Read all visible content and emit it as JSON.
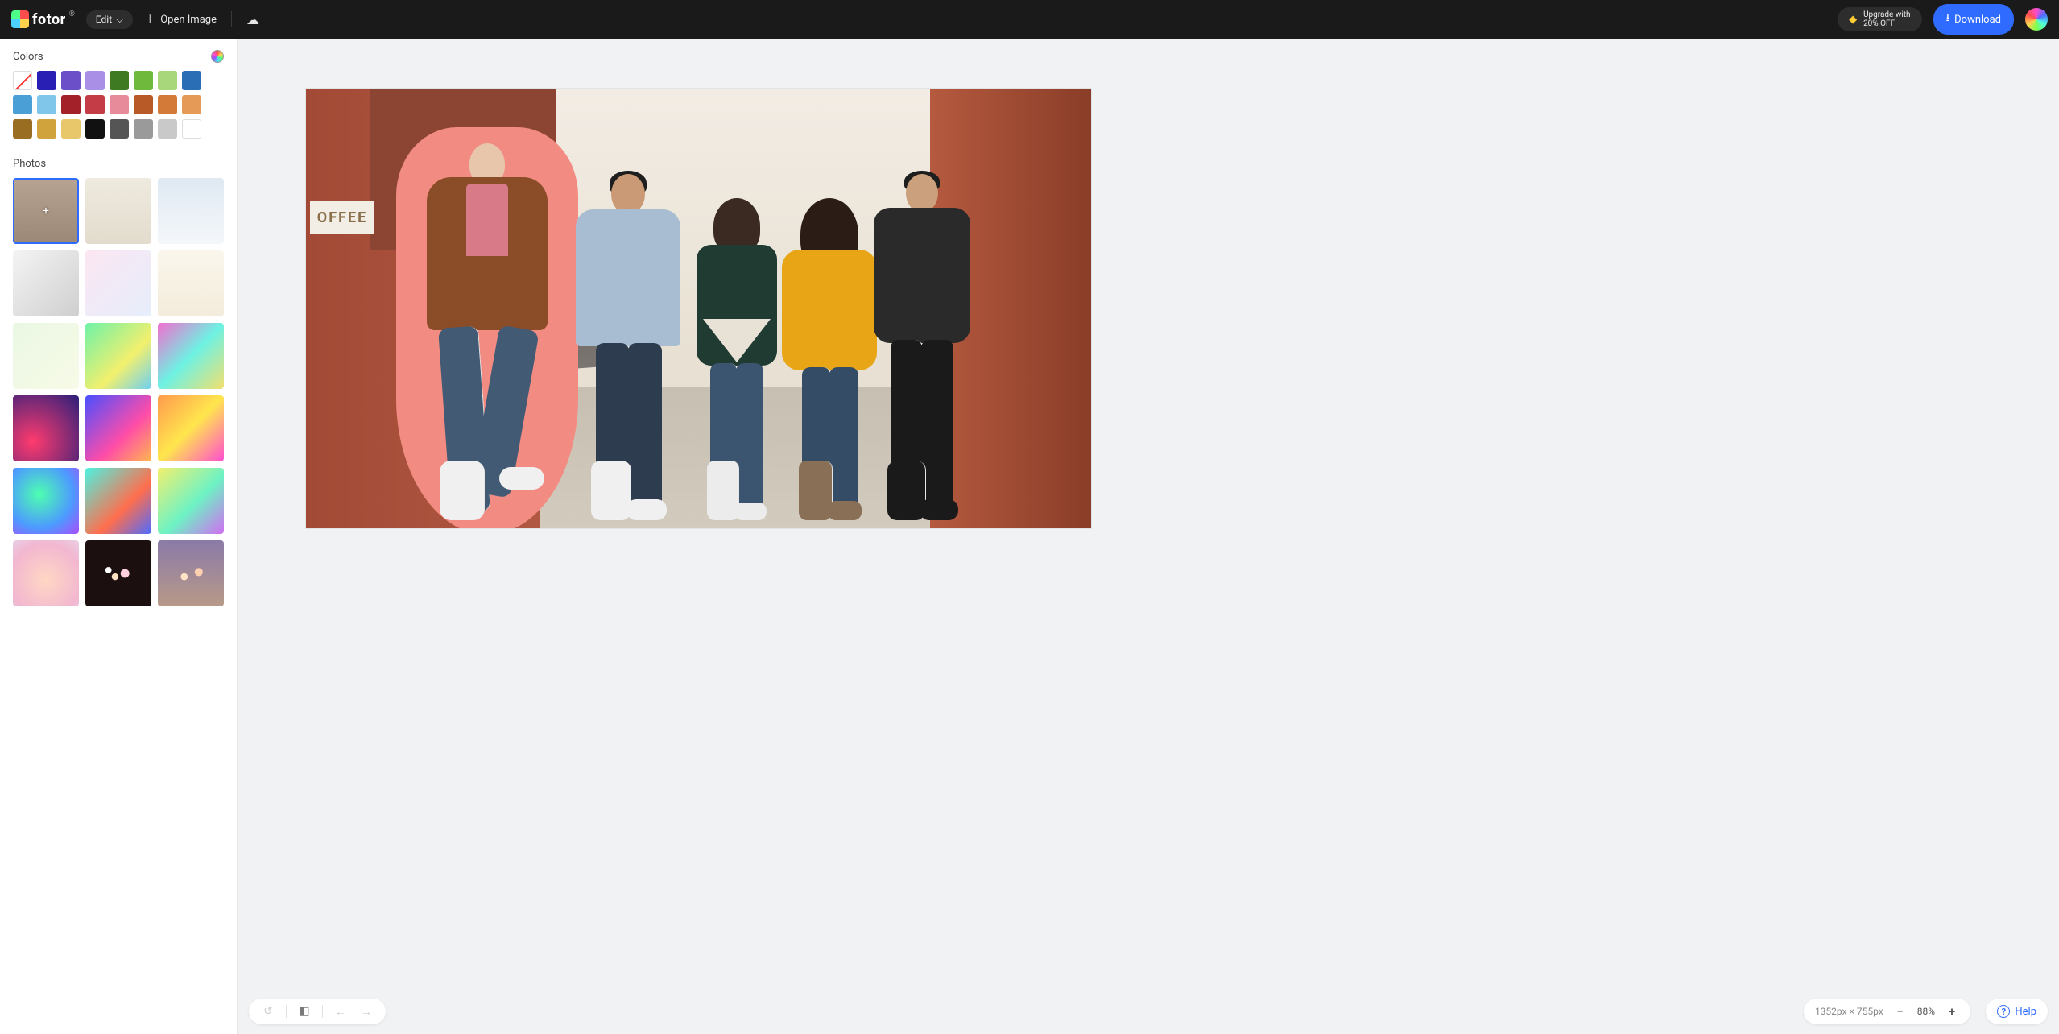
{
  "brand": {
    "name": "fotor"
  },
  "topbar": {
    "edit_label": "Edit",
    "open_image_label": "Open Image",
    "upgrade_line1": "Upgrade with",
    "upgrade_line2": "20% OFF",
    "download_label": "Download"
  },
  "sidebar": {
    "colors_title": "Colors",
    "photos_title": "Photos",
    "swatches": [
      "none",
      "#2a1fb5",
      "#6a4fc9",
      "#a98fe6",
      "#3d7a22",
      "#6fba3d",
      "#a8d67b",
      "#2a6fb5",
      "#4a9fd6",
      "#7fc6ea",
      "#a3222a",
      "#c43d46",
      "#e78a9a",
      "#b85a28",
      "#d47a38",
      "#e69a58",
      "#9a6e22",
      "#d1a33d",
      "#e8c76a",
      "#111111",
      "#555555",
      "#9a9a9a",
      "#c9c9c9",
      "#ffffff"
    ],
    "photos": [
      {
        "selected": true,
        "bg": "linear-gradient(#b7a391,#9c8876)"
      },
      {
        "selected": false,
        "bg": "linear-gradient(#efeadf,#e2dccd)"
      },
      {
        "selected": false,
        "bg": "linear-gradient(#dfe9f2,#f4f7fa)"
      },
      {
        "selected": false,
        "bg": "linear-gradient(135deg,#f4f4f4,#cfcfcf)"
      },
      {
        "selected": false,
        "bg": "linear-gradient(135deg,#fce6f2,#e6eefc)"
      },
      {
        "selected": false,
        "bg": "linear-gradient(#fbf6ec,#f3ecdb)"
      },
      {
        "selected": false,
        "bg": "linear-gradient(135deg,#eaf7e2,#f7fbe8)"
      },
      {
        "selected": false,
        "bg": "linear-gradient(135deg,#6ef2a8,#f2f06e 60%,#6ecff2)"
      },
      {
        "selected": false,
        "bg": "linear-gradient(135deg,#f26ed0,#6ef2e3 50%,#f2e06e)"
      },
      {
        "selected": false,
        "bg": "radial-gradient(circle at 30% 70%,#ff3b6e,#2a1f7a)"
      },
      {
        "selected": false,
        "bg": "linear-gradient(135deg,#4a4fff,#ff4da8 60%,#ffb84d)"
      },
      {
        "selected": false,
        "bg": "linear-gradient(135deg,#ff9a4d,#ffe64d 50%,#ff4dd0)"
      },
      {
        "selected": false,
        "bg": "radial-gradient(circle at 40% 40%,#4dffb0,#4d9aff 60%,#a84dff)"
      },
      {
        "selected": false,
        "bg": "linear-gradient(135deg,#4df2e0,#ff6e4d 60%,#4d6bff)"
      },
      {
        "selected": false,
        "bg": "linear-gradient(135deg,#f2f06e,#6ef2c4 55%,#d06ef2)"
      },
      {
        "selected": false,
        "bg": "radial-gradient(circle at 50% 60%,#ffd7c4,#f2b7d0 70%,#e8cfe6)"
      },
      {
        "selected": false,
        "bg": "radial-gradient(circle at 45% 55%,#ffe3c4 0 6%,transparent 7%),radial-gradient(circle at 60% 50%,#ffd0e0 0 8%,transparent 9%),radial-gradient(circle at 35% 45%,#fff 0 5%,transparent 6%),#1c0f0f"
      },
      {
        "selected": false,
        "bg": "radial-gradient(circle at 40% 55%,#ffe3c4 0 6%,transparent 7%),radial-gradient(circle at 62% 48%,#ffd0b0 0 7%,transparent 8%),linear-gradient(#8a7aa8,#b89a88)"
      }
    ]
  },
  "canvas": {
    "coffee_text": "OFFEE"
  },
  "status": {
    "dimensions": "1352px × 755px",
    "zoom": "88%"
  },
  "help": {
    "label": "Help"
  }
}
